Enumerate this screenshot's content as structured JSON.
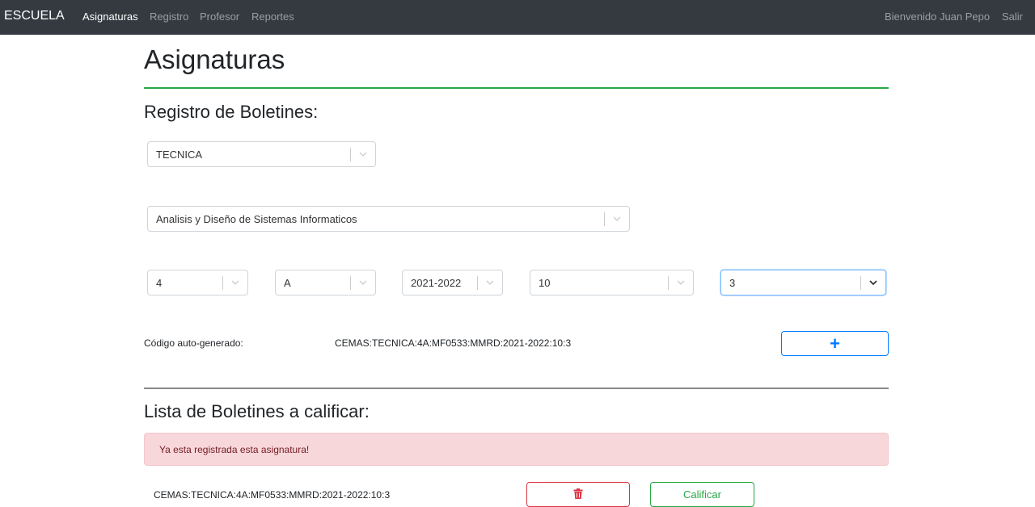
{
  "navbar": {
    "brand": "ESCUELA",
    "links": [
      {
        "label": "Asignaturas",
        "active": true
      },
      {
        "label": "Registro",
        "active": false
      },
      {
        "label": "Profesor",
        "active": false
      },
      {
        "label": "Reportes",
        "active": false
      }
    ],
    "welcome": "Bienvenido Juan Pepo",
    "logout": "Salir"
  },
  "page": {
    "title": "Asignaturas"
  },
  "registro": {
    "title": "Registro de Boletines:",
    "area_select": "TECNICA",
    "subject_select": "Analisis y Diseño de Sistemas Informaticos",
    "grade_select": "4",
    "section_select": "A",
    "year_select": "2021-2022",
    "field_four_select": "10",
    "field_five_select": "3",
    "code_label": "Código auto-generado:",
    "code_value": "CEMAS:TECNICA:4A:MF0533:MMRD:2021-2022:10:3",
    "add_label": "+"
  },
  "lista": {
    "title": "Lista de Boletines a calificar:",
    "alert": "Ya esta registrada esta asignatura!",
    "rows": [
      {
        "code": "CEMAS:TECNICA:4A:MF0533:MMRD:2021-2022:10:3",
        "grade_label": "Calificar"
      }
    ]
  },
  "colors": {
    "navbar": "#343a40",
    "accent_green": "#28a745",
    "accent_blue": "#007bff",
    "danger": "#dc3545",
    "alert_bg": "#f8d7da"
  },
  "icons": [
    "chevron-down-icon",
    "plus-icon",
    "trash-icon"
  ]
}
